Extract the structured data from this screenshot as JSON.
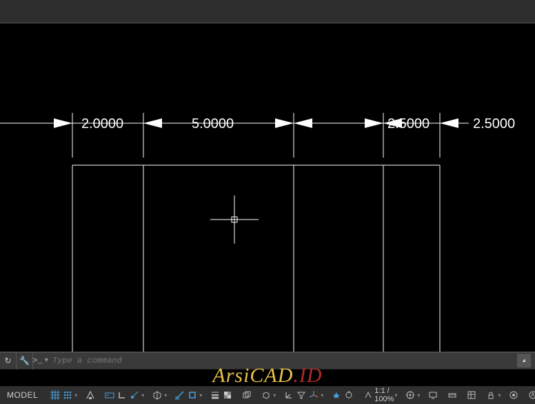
{
  "dimensions": {
    "d1": "2.0000",
    "d2": "5.0000",
    "d3": "2.5000",
    "d4": "2.5000"
  },
  "command": {
    "placeholder": "Type a command"
  },
  "watermark": {
    "part1": "ArsiCAD",
    "part2": ".ID"
  },
  "status": {
    "model": "MODEL",
    "scale": "1:1 / 100%"
  },
  "colors": {
    "accent": "#4aa3e0",
    "panel": "#2f2f2f",
    "text": "#d0d0d0"
  }
}
